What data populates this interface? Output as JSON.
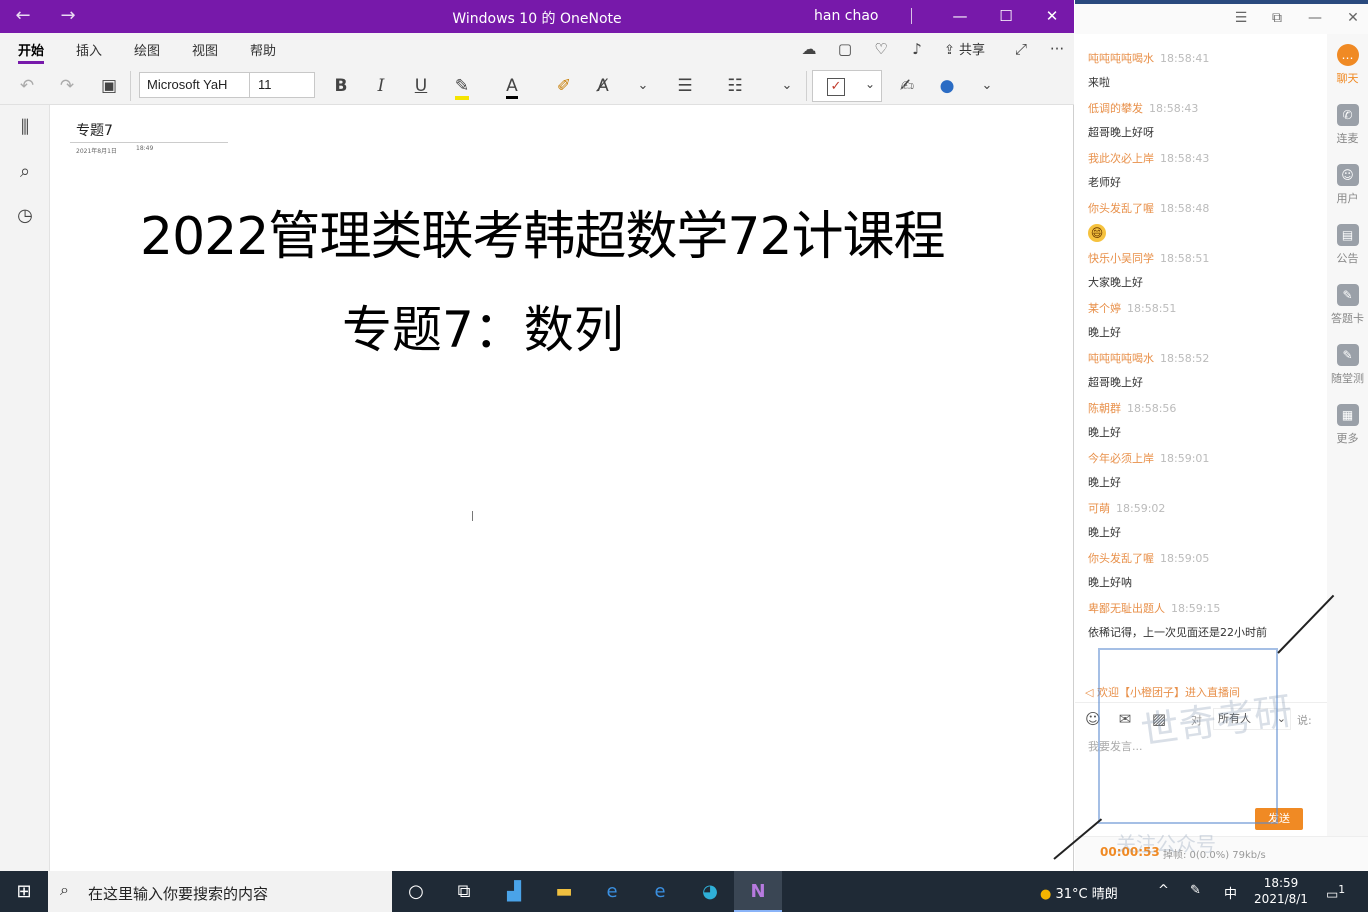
{
  "titlebar": {
    "back": "←",
    "forward": "→",
    "title": "Windows 10 的 OneNote",
    "user": "han chao",
    "minimize": "—",
    "maximize": "☐",
    "close": "✕"
  },
  "ribbon": {
    "tabs": [
      {
        "label": "开始",
        "active": true
      },
      {
        "label": "插入"
      },
      {
        "label": "绘图"
      },
      {
        "label": "视图"
      },
      {
        "label": "帮助"
      }
    ],
    "share": "共享",
    "more": "···"
  },
  "toolbar": {
    "font_name": "Microsoft YaH",
    "font_size": "11",
    "bold": "B",
    "italic": "I",
    "underline": "U",
    "font_color": "A",
    "todo_check": "✓",
    "dropdown": "⌄"
  },
  "page": {
    "title": "专题7",
    "date": "2021年8月1日",
    "time": "18:49",
    "heading1": "2022管理类联考韩超数学72计课程",
    "heading2": "专题7：数列"
  },
  "chat": {
    "window_controls": [
      "☰",
      "⧉",
      "—",
      "✕"
    ],
    "messages": [
      {
        "user": "吨吨吨吨喝水",
        "time": "18:58:41",
        "text": "来啦"
      },
      {
        "user": "低调的攀发",
        "time": "18:58:43",
        "text": "超哥晚上好呀"
      },
      {
        "user": "我此次必上岸",
        "time": "18:58:43",
        "text": "老师好"
      },
      {
        "user": "你头发乱了喔",
        "time": "18:58:48",
        "text": "😄"
      },
      {
        "user": "快乐小吴同学",
        "time": "18:58:51",
        "text": "大家晚上好"
      },
      {
        "user": "某个婷",
        "time": "18:58:51",
        "text": "晚上好"
      },
      {
        "user": "吨吨吨吨喝水",
        "time": "18:58:52",
        "text": "超哥晚上好"
      },
      {
        "user": "陈朝群",
        "time": "18:58:56",
        "text": "晚上好"
      },
      {
        "user": "今年必须上岸",
        "time": "18:59:01",
        "text": "晚上好"
      },
      {
        "user": "可萌",
        "time": "18:59:02",
        "text": "晚上好"
      },
      {
        "user": "你头发乱了喔",
        "time": "18:59:05",
        "text": "晚上好呐"
      },
      {
        "user": "卑鄙无耻出题人",
        "time": "18:59:15",
        "text": "依稀记得，上一次见面还是22小时前"
      }
    ],
    "notice": "欢迎【小橙团子】进入直播间",
    "to_label": "对",
    "recipient": "所有人",
    "say_label": "说:",
    "input_placeholder": "我要发言...",
    "send": "发送",
    "timer": "00:00:53",
    "drop_rate": "掉帧: 0(0.0%) 79kb/s",
    "side_nav": [
      {
        "label": "聊天",
        "icon": "…",
        "active": true
      },
      {
        "label": "连麦",
        "icon": "✆"
      },
      {
        "label": "用户",
        "icon": "☺"
      },
      {
        "label": "公告",
        "icon": "▤"
      },
      {
        "label": "答题卡",
        "icon": "✎"
      },
      {
        "label": "随堂测",
        "icon": "✎"
      },
      {
        "label": "更多",
        "icon": "▦"
      }
    ],
    "watermark": "世奇考研",
    "watermark_footer": "关注公众号"
  },
  "taskbar": {
    "start": "⊞",
    "search_placeholder": "在这里输入你要搜索的内容",
    "weather": "31°C 晴朗",
    "tray_up": "^",
    "ime": "中",
    "time": "18:59",
    "date": "2021/8/1",
    "notify_count": "1"
  },
  "colors": {
    "onenote_purple": "#7719aa",
    "chat_accent": "#f08a24",
    "taskbar": "#1f2a36"
  }
}
